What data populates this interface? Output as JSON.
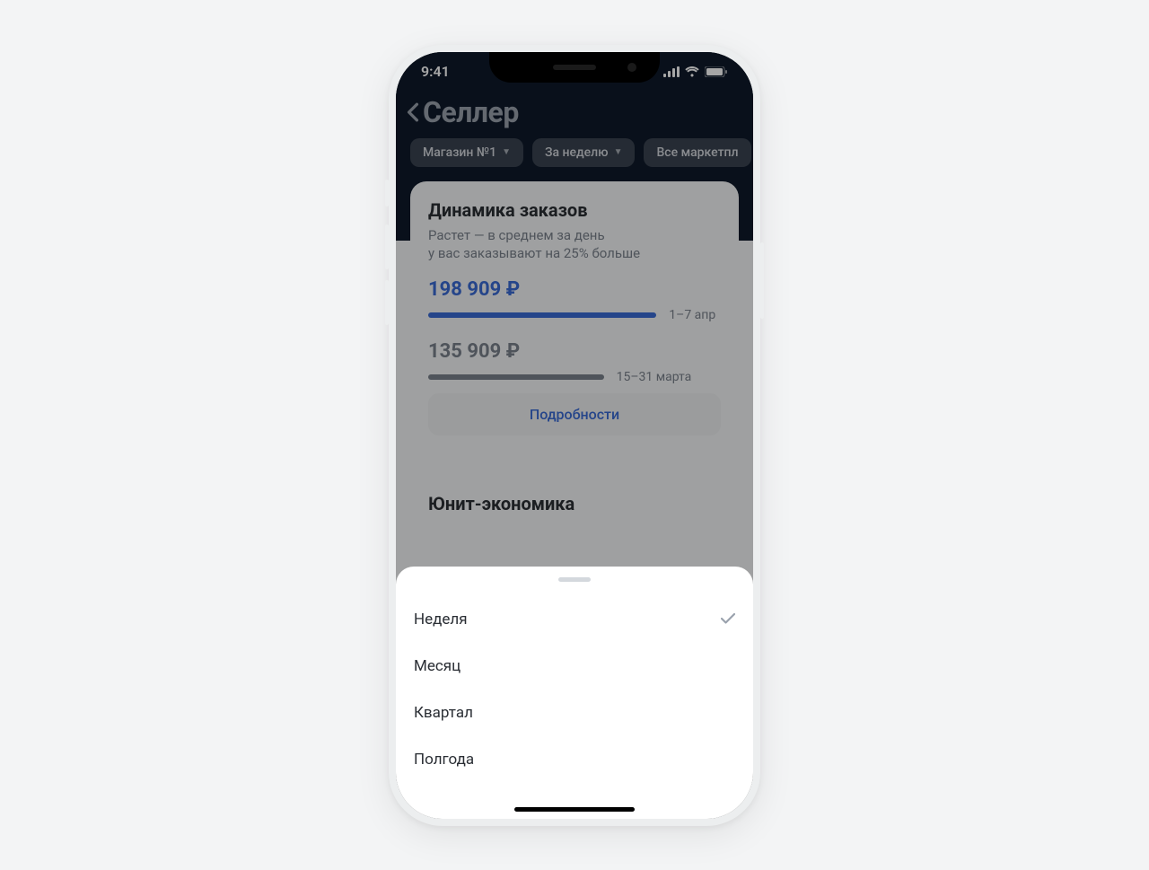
{
  "status_bar": {
    "time": "9:41"
  },
  "header": {
    "title": "Селлер"
  },
  "chips": [
    {
      "label": "Магазин №1"
    },
    {
      "label": "За неделю"
    },
    {
      "label": "Все маркетпл"
    }
  ],
  "card_orders": {
    "title": "Динамика заказов",
    "subtitle": "Растет — в среднем за день\nу вас заказывают на 25% больше",
    "current": {
      "amount": "198 909 ₽",
      "range": "1–7 апр",
      "bar_pct": 80
    },
    "previous": {
      "amount": "135 909 ₽",
      "range": "15–31 марта",
      "bar_pct": 60
    },
    "button": "Подробности"
  },
  "card_unit": {
    "title": "Юнит-экономика"
  },
  "sheet": {
    "options": [
      {
        "label": "Неделя",
        "selected": true
      },
      {
        "label": "Месяц",
        "selected": false
      },
      {
        "label": "Квартал",
        "selected": false
      },
      {
        "label": "Полгода",
        "selected": false
      }
    ]
  }
}
